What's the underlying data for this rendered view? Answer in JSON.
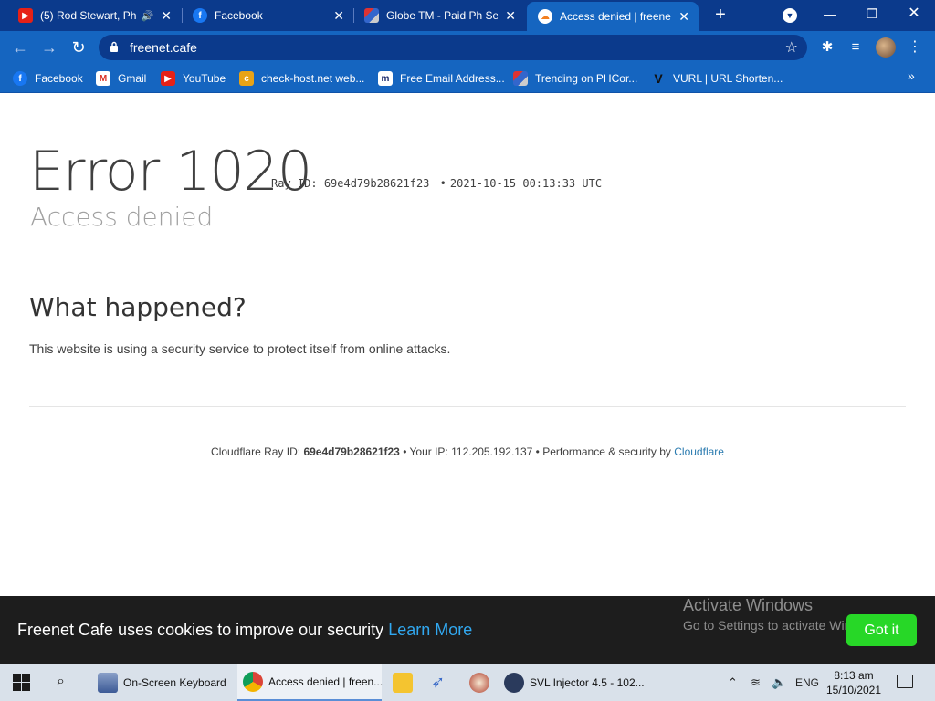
{
  "browser": {
    "tabs": [
      {
        "title": "(5) Rod Stewart, Ph",
        "icon": "youtube-icon",
        "audio": true
      },
      {
        "title": "Facebook",
        "icon": "facebook-icon"
      },
      {
        "title": "Globe TM - Paid Ph Ser",
        "icon": "globe-cube-icon"
      },
      {
        "title": "Access denied | freenet.",
        "icon": "cloudflare-icon",
        "active": true
      }
    ],
    "url": "freenet.cafe",
    "bookmarks": [
      {
        "label": "Facebook",
        "icon": "facebook-icon"
      },
      {
        "label": "Gmail",
        "icon": "gmail-icon"
      },
      {
        "label": "YouTube",
        "icon": "youtube-icon"
      },
      {
        "label": "check-host.net web...",
        "icon": "check-host-icon"
      },
      {
        "label": "Free Email Address...",
        "icon": "m-icon"
      },
      {
        "label": "Trending on PHCor...",
        "icon": "cube-icon"
      },
      {
        "label": "VURL | URL Shorten...",
        "icon": "v-icon"
      }
    ]
  },
  "page": {
    "error_title": "Error 1020",
    "ray_label": "Ray ID:",
    "ray_id": "69e4d79b28621f23",
    "bullet": "•",
    "timestamp": "2021-10-15 00:13:33 UTC",
    "subtitle": "Access denied",
    "what_happened": "What happened?",
    "description": "This website is using a security service to protect itself from online attacks.",
    "footer": {
      "ray_label": "Cloudflare Ray ID:",
      "ray_id": "69e4d79b28621f23",
      "ip_text": "• Your IP: 112.205.192.137 •",
      "perf_text": "Performance & security by",
      "cloudflare_link": "Cloudflare"
    }
  },
  "cookie_banner": {
    "message": "Freenet Cafe uses cookies to improve our security",
    "learn_more": "Learn More",
    "button": "Got it"
  },
  "watermark": {
    "line1": "Activate Windows",
    "line2": "Go to Settings to activate Windows."
  },
  "taskbar": {
    "apps": [
      {
        "label": "On-Screen Keyboard"
      },
      {
        "label": "Access denied | freen..."
      },
      {
        "label": ""
      },
      {
        "label": ""
      },
      {
        "label": ""
      },
      {
        "label": "SVL Injector 4.5 - 102..."
      }
    ],
    "language": "ENG",
    "time": "8:13 am",
    "date": "15/10/2021"
  },
  "colors": {
    "chrome_dark": "#0b3a8c",
    "chrome": "#1565c0",
    "link": "#2c7cb0",
    "got_it": "#27d727"
  }
}
